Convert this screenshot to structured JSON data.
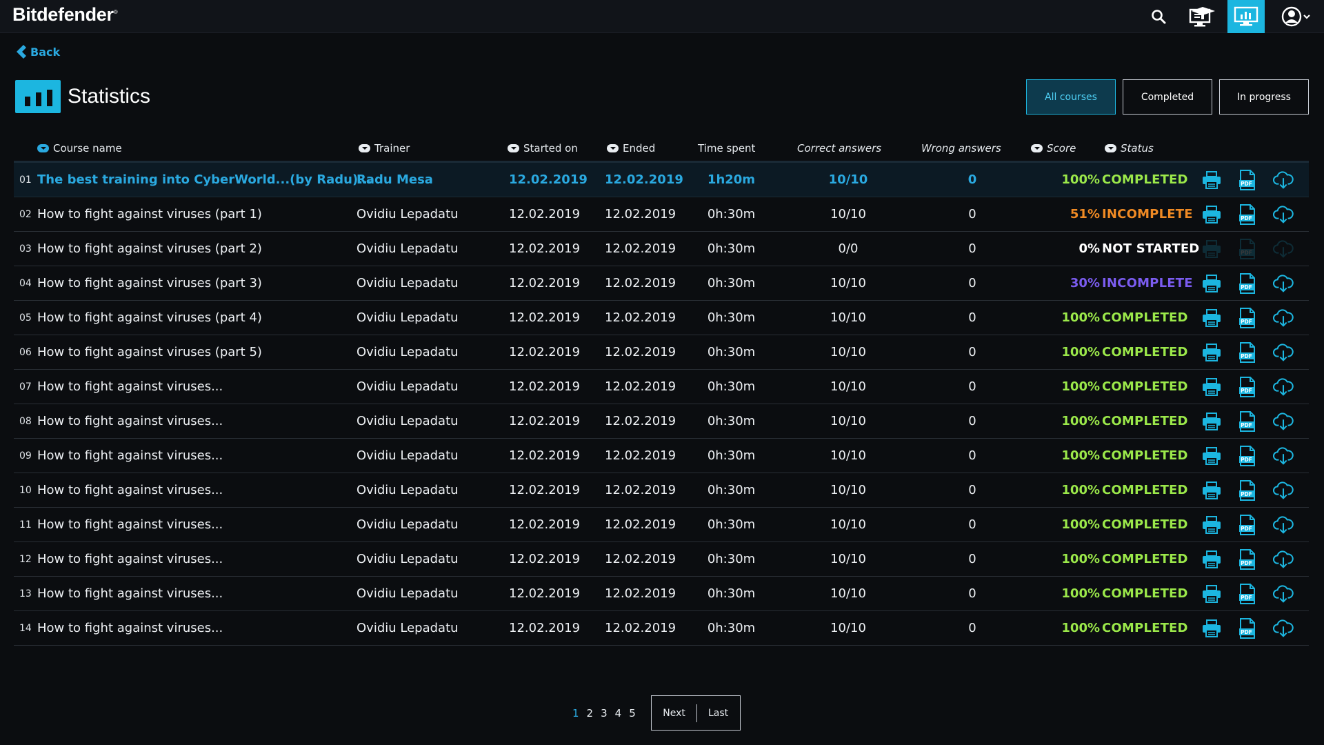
{
  "brand": {
    "name": "Bitdefender",
    "mark": "®"
  },
  "back": {
    "label": "Back"
  },
  "page": {
    "title": "Statistics"
  },
  "filters": [
    {
      "label": "All courses",
      "active": true
    },
    {
      "label": "Completed",
      "active": false
    },
    {
      "label": "In progress",
      "active": false
    }
  ],
  "columns": {
    "course_name": "Course name",
    "trainer": "Trainer",
    "started_on": "Started on",
    "ended": "Ended",
    "time_spent": "Time spent",
    "correct_answers": "Correct answers",
    "wrong_answers": "Wrong answers",
    "score": "Score",
    "status": "Status"
  },
  "colors": {
    "accent": "#1cb6e0",
    "completed": "#9be84a",
    "incomplete_orange": "#f08a24",
    "incomplete_purple": "#7b5cf0",
    "not_started": "#ffffff"
  },
  "rows": [
    {
      "num": "01",
      "name": "The best training into CyberWorld...(by Radu)...",
      "trainer": "Radu Mesa",
      "started": "12.02.2019",
      "ended": "12.02.2019",
      "time": "1h20m",
      "correct": "10/10",
      "wrong": "0",
      "score": "100%",
      "status": "COMPLETED",
      "status_color": "#9be84a",
      "highlight": true,
      "dim": false
    },
    {
      "num": "02",
      "name": "How to fight against viruses (part 1)",
      "trainer": "Ovidiu Lepadatu",
      "started": "12.02.2019",
      "ended": "12.02.2019",
      "time": "0h:30m",
      "correct": "10/10",
      "wrong": "0",
      "score": "51%",
      "status": "INCOMPLETE",
      "status_color": "#f08a24",
      "highlight": false,
      "dim": false
    },
    {
      "num": "03",
      "name": "How to fight against viruses (part 2)",
      "trainer": "Ovidiu Lepadatu",
      "started": "12.02.2019",
      "ended": "12.02.2019",
      "time": "0h:30m",
      "correct": "0/0",
      "wrong": "0",
      "score": "0%",
      "status": "NOT STARTED",
      "status_color": "#ffffff",
      "highlight": false,
      "dim": true
    },
    {
      "num": "04",
      "name": "How to fight against viruses (part 3)",
      "trainer": "Ovidiu Lepadatu",
      "started": "12.02.2019",
      "ended": "12.02.2019",
      "time": "0h:30m",
      "correct": "10/10",
      "wrong": "0",
      "score": "30%",
      "status": "INCOMPLETE",
      "status_color": "#7b5cf0",
      "highlight": false,
      "dim": false
    },
    {
      "num": "05",
      "name": "How to fight against viruses (part 4)",
      "trainer": "Ovidiu Lepadatu",
      "started": "12.02.2019",
      "ended": "12.02.2019",
      "time": "0h:30m",
      "correct": "10/10",
      "wrong": "0",
      "score": "100%",
      "status": "COMPLETED",
      "status_color": "#9be84a",
      "highlight": false,
      "dim": false
    },
    {
      "num": "06",
      "name": "How to fight against viruses (part 5)",
      "trainer": "Ovidiu Lepadatu",
      "started": "12.02.2019",
      "ended": "12.02.2019",
      "time": "0h:30m",
      "correct": "10/10",
      "wrong": "0",
      "score": "100%",
      "status": "COMPLETED",
      "status_color": "#9be84a",
      "highlight": false,
      "dim": false
    },
    {
      "num": "07",
      "name": "How to fight against viruses...",
      "trainer": "Ovidiu Lepadatu",
      "started": "12.02.2019",
      "ended": "12.02.2019",
      "time": "0h:30m",
      "correct": "10/10",
      "wrong": "0",
      "score": "100%",
      "status": "COMPLETED",
      "status_color": "#9be84a",
      "highlight": false,
      "dim": false
    },
    {
      "num": "08",
      "name": "How to fight against viruses...",
      "trainer": "Ovidiu Lepadatu",
      "started": "12.02.2019",
      "ended": "12.02.2019",
      "time": "0h:30m",
      "correct": "10/10",
      "wrong": "0",
      "score": "100%",
      "status": "COMPLETED",
      "status_color": "#9be84a",
      "highlight": false,
      "dim": false
    },
    {
      "num": "09",
      "name": "How to fight against viruses...",
      "trainer": "Ovidiu Lepadatu",
      "started": "12.02.2019",
      "ended": "12.02.2019",
      "time": "0h:30m",
      "correct": "10/10",
      "wrong": "0",
      "score": "100%",
      "status": "COMPLETED",
      "status_color": "#9be84a",
      "highlight": false,
      "dim": false
    },
    {
      "num": "10",
      "name": "How to fight against viruses...",
      "trainer": "Ovidiu Lepadatu",
      "started": "12.02.2019",
      "ended": "12.02.2019",
      "time": "0h:30m",
      "correct": "10/10",
      "wrong": "0",
      "score": "100%",
      "status": "COMPLETED",
      "status_color": "#9be84a",
      "highlight": false,
      "dim": false
    },
    {
      "num": "11",
      "name": "How to fight against viruses...",
      "trainer": "Ovidiu Lepadatu",
      "started": "12.02.2019",
      "ended": "12.02.2019",
      "time": "0h:30m",
      "correct": "10/10",
      "wrong": "0",
      "score": "100%",
      "status": "COMPLETED",
      "status_color": "#9be84a",
      "highlight": false,
      "dim": false
    },
    {
      "num": "12",
      "name": "How to fight against viruses...",
      "trainer": "Ovidiu Lepadatu",
      "started": "12.02.2019",
      "ended": "12.02.2019",
      "time": "0h:30m",
      "correct": "10/10",
      "wrong": "0",
      "score": "100%",
      "status": "COMPLETED",
      "status_color": "#9be84a",
      "highlight": false,
      "dim": false
    },
    {
      "num": "13",
      "name": "How to fight against viruses...",
      "trainer": "Ovidiu Lepadatu",
      "started": "12.02.2019",
      "ended": "12.02.2019",
      "time": "0h:30m",
      "correct": "10/10",
      "wrong": "0",
      "score": "100%",
      "status": "COMPLETED",
      "status_color": "#9be84a",
      "highlight": false,
      "dim": false
    },
    {
      "num": "14",
      "name": "How to fight against viruses...",
      "trainer": "Ovidiu Lepadatu",
      "started": "12.02.2019",
      "ended": "12.02.2019",
      "time": "0h:30m",
      "correct": "10/10",
      "wrong": "0",
      "score": "100%",
      "status": "COMPLETED",
      "status_color": "#9be84a",
      "highlight": false,
      "dim": false
    }
  ],
  "row_icons": {
    "print": "printer-icon",
    "pdf": "pdf-icon",
    "download": "cloud-download-icon",
    "pdf_text": "PDF"
  },
  "topbar_icons": [
    "search-icon",
    "training-monitor-icon",
    "statistics-monitor-icon",
    "user-account-icon"
  ],
  "pagination": {
    "pages": [
      "1",
      "2",
      "3",
      "4",
      "5"
    ],
    "current": "1",
    "next_label": "Next",
    "last_label": "Last"
  }
}
